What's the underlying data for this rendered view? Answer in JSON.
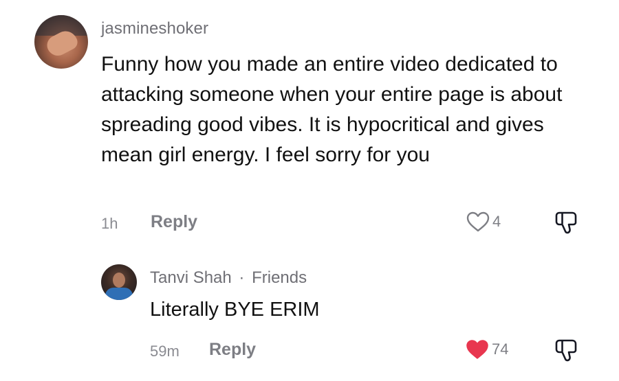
{
  "comment": {
    "username": "jasmineshoker",
    "text": "Funny how you made an entire video dedicated to attacking someone when your entire page is about spreading good vibes. It is hypocritical and gives mean girl energy. I feel sorry for you",
    "time": "1h",
    "reply_label": "Reply",
    "likes": "4",
    "liked": false
  },
  "reply": {
    "name": "Tanvi Shah",
    "separator": "·",
    "relation": "Friends",
    "text": "Literally BYE ERIM",
    "time": "59m",
    "reply_label": "Reply",
    "likes": "74",
    "liked": true
  },
  "colors": {
    "like_active": "#e8364f",
    "like_inactive": "#7d7e84",
    "meta": "#8a8b91"
  },
  "icons": {
    "heart": "heart-icon",
    "dislike": "thumbs-down-icon"
  }
}
